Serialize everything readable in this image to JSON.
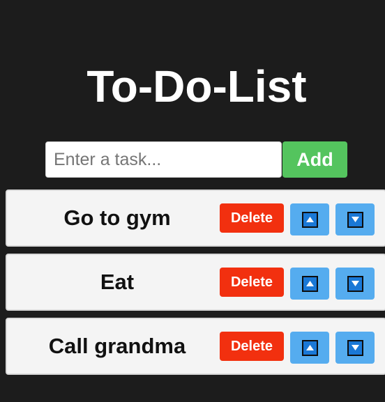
{
  "page": {
    "title": "To-Do-List"
  },
  "entry": {
    "placeholder": "Enter a task...",
    "value": "",
    "add_label": "Add"
  },
  "tasks": [
    {
      "text": "Go to gym",
      "delete_label": "Delete"
    },
    {
      "text": "Eat",
      "delete_label": "Delete"
    },
    {
      "text": "Call grandma",
      "delete_label": "Delete"
    }
  ],
  "icons": {
    "move_up": "arrow-up-icon",
    "move_down": "arrow-down-icon"
  },
  "colors": {
    "background": "#1c1c1c",
    "add_button": "#54c45e",
    "delete_button": "#f2300f",
    "move_button": "#55acef",
    "arrow_fill": "#1a78d6",
    "row_background": "#f4f4f4"
  }
}
